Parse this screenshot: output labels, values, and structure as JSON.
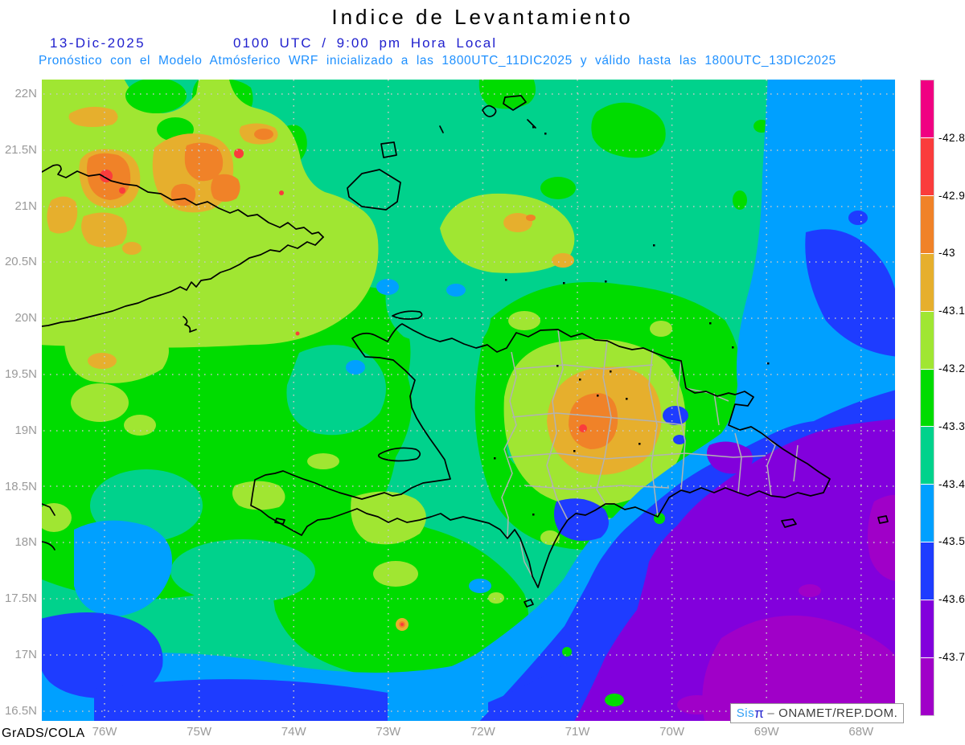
{
  "title": "Indice de Levantamiento",
  "header": {
    "date": "13-Dic-2025",
    "time": "0100 UTC / 9:00 pm Hora Local",
    "model": "Pronóstico con el Modelo Atmósferico WRF inicializado a las 1800UTC_11DIC2025 y válido hasta las  1800UTC_13DIC2025"
  },
  "credits": {
    "engine": "GrADS/COLA",
    "sis": "Sis",
    "pi": "π",
    "sep": "–",
    "org": "ONAMET/REP.DOM."
  },
  "axes": {
    "lat_labels": [
      "22N",
      "21.5N",
      "21N",
      "20.5N",
      "20N",
      "19.5N",
      "19N",
      "18.5N",
      "18N",
      "17.5N",
      "17N",
      "16.5N"
    ],
    "lon_labels": [
      "76W",
      "75W",
      "74W",
      "73W",
      "72W",
      "71W",
      "70W",
      "69W",
      "68W"
    ]
  },
  "colorbar": {
    "colors_top_to_bottom": [
      "#F00082",
      "#FA3C3C",
      "#F08228",
      "#E6AF2D",
      "#A0E632",
      "#00DC00",
      "#00D28C",
      "#00A0FF",
      "#1E3CFF",
      "#8200DC",
      "#A000C8"
    ],
    "boundary_labels": [
      "-42.8",
      "-42.9",
      "-43",
      "-43.1",
      "-43.2",
      "-43.3",
      "-43.4",
      "-43.5",
      "-43.6",
      "-43.7"
    ]
  },
  "palette": {
    "magenta": "#F00082",
    "red": "#FA3C3C",
    "orange": "#F08228",
    "golden": "#E6AF2D",
    "yellow_green": "#A0E632",
    "green": "#00DC00",
    "teal": "#00D28C",
    "sky_blue": "#00A0FF",
    "blue": "#1E3CFF",
    "violet": "#8200DC",
    "purple": "#A000C8",
    "coastline": "#000000",
    "province_border": "#B2B2B2",
    "gridline": "#C8C8C8",
    "axis_text": "#9A9A9A",
    "header_blue": "#2121CE",
    "subtitle_blue": "#1E90FF"
  },
  "chart_data": {
    "type": "heatmap",
    "title": "Indice de Levantamiento",
    "legend_position": "right",
    "levels": [
      -42.8,
      -42.9,
      -43,
      -43.1,
      -43.2,
      -43.3,
      -43.4,
      -43.5,
      -43.6,
      -43.7
    ],
    "level_colors_high_to_low": [
      "#F00082",
      "#FA3C3C",
      "#F08228",
      "#E6AF2D",
      "#A0E632",
      "#00DC00",
      "#00D28C",
      "#00A0FF",
      "#1E3CFF",
      "#8200DC",
      "#A000C8"
    ],
    "x_ticks": [
      "76W",
      "75W",
      "74W",
      "73W",
      "72W",
      "71W",
      "70W",
      "69W",
      "68W"
    ],
    "y_ticks": [
      "22N",
      "21.5N",
      "21N",
      "20.5N",
      "20N",
      "19.5N",
      "19N",
      "18.5N",
      "18N",
      "17.5N",
      "17N",
      "16.5N"
    ],
    "grid": "dotted",
    "annotations": [
      "orange/red maxima (≈ -42.8 to -43) over eastern Cuba near 75-76W, 21N",
      "secondary warm maximum (golden/orange) over central Dominican Republic near 70.7W, 19.2N",
      "field decreases southeastward: sky blue and blue over eastern Hispaniola waters",
      "violet/purple minimum (below -43.6 / -43.7) over the southeast corner of the domain"
    ]
  }
}
